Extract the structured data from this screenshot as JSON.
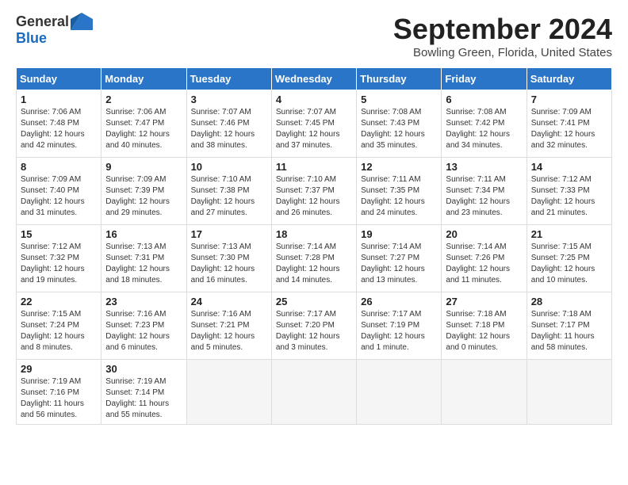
{
  "logo": {
    "general": "General",
    "blue": "Blue"
  },
  "title": {
    "month": "September 2024",
    "location": "Bowling Green, Florida, United States"
  },
  "headers": [
    "Sunday",
    "Monday",
    "Tuesday",
    "Wednesday",
    "Thursday",
    "Friday",
    "Saturday"
  ],
  "weeks": [
    [
      {
        "day": "1",
        "info": "Sunrise: 7:06 AM\nSunset: 7:48 PM\nDaylight: 12 hours\nand 42 minutes."
      },
      {
        "day": "2",
        "info": "Sunrise: 7:06 AM\nSunset: 7:47 PM\nDaylight: 12 hours\nand 40 minutes."
      },
      {
        "day": "3",
        "info": "Sunrise: 7:07 AM\nSunset: 7:46 PM\nDaylight: 12 hours\nand 38 minutes."
      },
      {
        "day": "4",
        "info": "Sunrise: 7:07 AM\nSunset: 7:45 PM\nDaylight: 12 hours\nand 37 minutes."
      },
      {
        "day": "5",
        "info": "Sunrise: 7:08 AM\nSunset: 7:43 PM\nDaylight: 12 hours\nand 35 minutes."
      },
      {
        "day": "6",
        "info": "Sunrise: 7:08 AM\nSunset: 7:42 PM\nDaylight: 12 hours\nand 34 minutes."
      },
      {
        "day": "7",
        "info": "Sunrise: 7:09 AM\nSunset: 7:41 PM\nDaylight: 12 hours\nand 32 minutes."
      }
    ],
    [
      {
        "day": "8",
        "info": "Sunrise: 7:09 AM\nSunset: 7:40 PM\nDaylight: 12 hours\nand 31 minutes."
      },
      {
        "day": "9",
        "info": "Sunrise: 7:09 AM\nSunset: 7:39 PM\nDaylight: 12 hours\nand 29 minutes."
      },
      {
        "day": "10",
        "info": "Sunrise: 7:10 AM\nSunset: 7:38 PM\nDaylight: 12 hours\nand 27 minutes."
      },
      {
        "day": "11",
        "info": "Sunrise: 7:10 AM\nSunset: 7:37 PM\nDaylight: 12 hours\nand 26 minutes."
      },
      {
        "day": "12",
        "info": "Sunrise: 7:11 AM\nSunset: 7:35 PM\nDaylight: 12 hours\nand 24 minutes."
      },
      {
        "day": "13",
        "info": "Sunrise: 7:11 AM\nSunset: 7:34 PM\nDaylight: 12 hours\nand 23 minutes."
      },
      {
        "day": "14",
        "info": "Sunrise: 7:12 AM\nSunset: 7:33 PM\nDaylight: 12 hours\nand 21 minutes."
      }
    ],
    [
      {
        "day": "15",
        "info": "Sunrise: 7:12 AM\nSunset: 7:32 PM\nDaylight: 12 hours\nand 19 minutes."
      },
      {
        "day": "16",
        "info": "Sunrise: 7:13 AM\nSunset: 7:31 PM\nDaylight: 12 hours\nand 18 minutes."
      },
      {
        "day": "17",
        "info": "Sunrise: 7:13 AM\nSunset: 7:30 PM\nDaylight: 12 hours\nand 16 minutes."
      },
      {
        "day": "18",
        "info": "Sunrise: 7:14 AM\nSunset: 7:28 PM\nDaylight: 12 hours\nand 14 minutes."
      },
      {
        "day": "19",
        "info": "Sunrise: 7:14 AM\nSunset: 7:27 PM\nDaylight: 12 hours\nand 13 minutes."
      },
      {
        "day": "20",
        "info": "Sunrise: 7:14 AM\nSunset: 7:26 PM\nDaylight: 12 hours\nand 11 minutes."
      },
      {
        "day": "21",
        "info": "Sunrise: 7:15 AM\nSunset: 7:25 PM\nDaylight: 12 hours\nand 10 minutes."
      }
    ],
    [
      {
        "day": "22",
        "info": "Sunrise: 7:15 AM\nSunset: 7:24 PM\nDaylight: 12 hours\nand 8 minutes."
      },
      {
        "day": "23",
        "info": "Sunrise: 7:16 AM\nSunset: 7:23 PM\nDaylight: 12 hours\nand 6 minutes."
      },
      {
        "day": "24",
        "info": "Sunrise: 7:16 AM\nSunset: 7:21 PM\nDaylight: 12 hours\nand 5 minutes."
      },
      {
        "day": "25",
        "info": "Sunrise: 7:17 AM\nSunset: 7:20 PM\nDaylight: 12 hours\nand 3 minutes."
      },
      {
        "day": "26",
        "info": "Sunrise: 7:17 AM\nSunset: 7:19 PM\nDaylight: 12 hours\nand 1 minute."
      },
      {
        "day": "27",
        "info": "Sunrise: 7:18 AM\nSunset: 7:18 PM\nDaylight: 12 hours\nand 0 minutes."
      },
      {
        "day": "28",
        "info": "Sunrise: 7:18 AM\nSunset: 7:17 PM\nDaylight: 11 hours\nand 58 minutes."
      }
    ],
    [
      {
        "day": "29",
        "info": "Sunrise: 7:19 AM\nSunset: 7:16 PM\nDaylight: 11 hours\nand 56 minutes."
      },
      {
        "day": "30",
        "info": "Sunrise: 7:19 AM\nSunset: 7:14 PM\nDaylight: 11 hours\nand 55 minutes."
      },
      {
        "day": "",
        "info": ""
      },
      {
        "day": "",
        "info": ""
      },
      {
        "day": "",
        "info": ""
      },
      {
        "day": "",
        "info": ""
      },
      {
        "day": "",
        "info": ""
      }
    ]
  ]
}
